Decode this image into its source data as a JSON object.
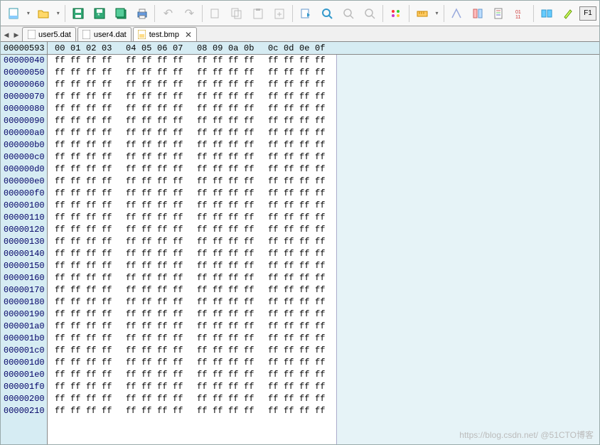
{
  "toolbar": {
    "new_file": "new-file",
    "open": "open",
    "save": "save",
    "save_new": "save-new",
    "save_all": "save-all",
    "print": "print",
    "undo": "undo",
    "redo": "redo",
    "cut": "cut",
    "copy": "copy",
    "paste": "paste",
    "paste_special": "paste-special",
    "find": "find",
    "zoom_in": "zoom-in",
    "zoom_out": "zoom-out",
    "zoom_fit": "zoom-fit",
    "highlight": "highlight",
    "hex_view": "hex-view",
    "bookmark": "bookmark",
    "bookmark_list": "bookmark-list",
    "template": "template",
    "binary": "binary",
    "compare": "compare",
    "marker": "marker",
    "help": "F1"
  },
  "tabs": {
    "prev": "◀",
    "next": "▶",
    "items": [
      {
        "label": "user5.dat",
        "active": false,
        "closable": false
      },
      {
        "label": "user4.dat",
        "active": false,
        "closable": false
      },
      {
        "label": "test.bmp",
        "active": true,
        "closable": true,
        "close": "✕"
      }
    ]
  },
  "header": {
    "position": "00000593",
    "cols": [
      "00",
      "01",
      "02",
      "03",
      "04",
      "05",
      "06",
      "07",
      "08",
      "09",
      "0a",
      "0b",
      "0c",
      "0d",
      "0e",
      "0f"
    ]
  },
  "rows": [
    "00000040",
    "00000050",
    "00000060",
    "00000070",
    "00000080",
    "00000090",
    "000000a0",
    "000000b0",
    "000000c0",
    "000000d0",
    "000000e0",
    "000000f0",
    "00000100",
    "00000110",
    "00000120",
    "00000130",
    "00000140",
    "00000150",
    "00000160",
    "00000170",
    "00000180",
    "00000190",
    "000001a0",
    "000001b0",
    "000001c0",
    "000001d0",
    "000001e0",
    "000001f0",
    "00000200",
    "00000210"
  ],
  "byte": "ff",
  "watermark": "https://blog.csdn.net/ @51CTO博客"
}
